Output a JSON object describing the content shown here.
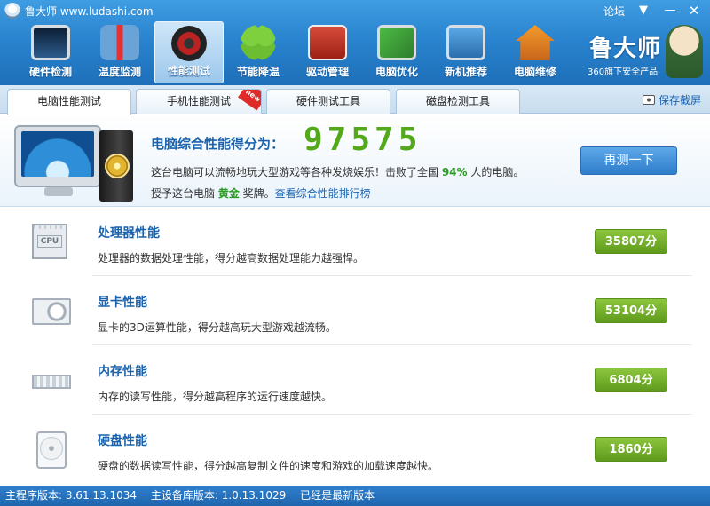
{
  "window": {
    "title": "鲁大师 www.ludashi.com",
    "forum": "论坛",
    "menu_glyph": "▼",
    "min_glyph": "—",
    "close_glyph": "✕"
  },
  "nav": {
    "items": [
      {
        "label": "硬件检测",
        "icon": "monitor-magnifier-icon"
      },
      {
        "label": "温度监测",
        "icon": "thermometer-icon"
      },
      {
        "label": "性能测试",
        "icon": "speed-gauge-icon",
        "active": true
      },
      {
        "label": "节能降温",
        "icon": "clover-icon"
      },
      {
        "label": "驱动管理",
        "icon": "driver-chip-icon"
      },
      {
        "label": "电脑优化",
        "icon": "optimize-screen-icon"
      },
      {
        "label": "新机推荐",
        "icon": "new-pc-award-icon"
      },
      {
        "label": "电脑维修",
        "icon": "house-repair-icon"
      }
    ]
  },
  "brand": {
    "name": "鲁大师",
    "sub": "360旗下安全产品"
  },
  "tabs": [
    {
      "label": "电脑性能测试",
      "active": true
    },
    {
      "label": "手机性能测试",
      "badge": "new"
    },
    {
      "label": "硬件测试工具"
    },
    {
      "label": "磁盘检测工具"
    }
  ],
  "save_screenshot": "保存截屏",
  "summary": {
    "title": "电脑综合性能得分为：",
    "score": "97575",
    "desc_prefix": "这台电脑可以流畅地玩大型游戏等各种发烧娱乐！击败了全国 ",
    "percent": "94%",
    "desc_suffix": " 人的电脑。",
    "award_prefix": "授予这台电脑 ",
    "award": "黄金",
    "award_suffix": " 奖牌。",
    "rank_link": "查看综合性能排行榜",
    "retest": "再测一下"
  },
  "rows": [
    {
      "title": "处理器性能",
      "desc": "处理器的数据处理性能，得分越高数据处理能力越强悍。",
      "score": "35807分",
      "icon": "cpu-icon",
      "cpu_label": "CPU"
    },
    {
      "title": "显卡性能",
      "desc": "显卡的3D运算性能，得分越高玩大型游戏越流畅。",
      "score": "53104分",
      "icon": "graphics-card-icon"
    },
    {
      "title": "内存性能",
      "desc": "内存的读写性能，得分越高程序的运行速度越快。",
      "score": "6804分",
      "icon": "memory-stick-icon"
    },
    {
      "title": "硬盘性能",
      "desc": "硬盘的数据读写性能，得分越高复制文件的速度和游戏的加载速度越快。",
      "score": "1860分",
      "icon": "hard-disk-icon"
    }
  ],
  "status": {
    "main_version": "主程序版本: 3.61.13.1034",
    "db_version": "主设备库版本: 1.0.13.1029",
    "latest": "已经是最新版本"
  }
}
